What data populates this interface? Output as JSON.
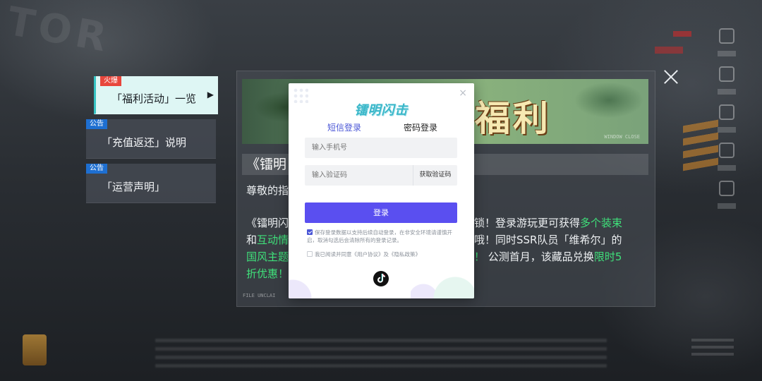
{
  "sidebar": {
    "items": [
      {
        "tag": "火爆",
        "label": "「福利活动」一览",
        "active": true
      },
      {
        "tag": "公告",
        "label": "「充值返还」说明",
        "active": false
      },
      {
        "tag": "公告",
        "label": "「运营声明」",
        "active": false
      }
    ],
    "active_arrow": "▶"
  },
  "announcement": {
    "banner_title": "福利",
    "banner_small": "WINDOW CLOSE",
    "heading": "《镭明",
    "greeting": "尊敬的指",
    "paragraph": {
      "line1_a": "《镭明闪",
      "line1_b": "锁！登录游玩更可获得",
      "line1_green": "多个装束",
      "line2_a": "和",
      "line2_green": "互动情",
      "line2_b": "哦！同时SSR队员「维希尔」的",
      "line3_green_a": "国风主题",
      "line3_green_b": "！",
      "line3_b": "公测首月，该藏品兑换",
      "line3_green_c": "限时5",
      "line4_green": "折优惠！"
    },
    "file_note": "FILE UNCLAI"
  },
  "login": {
    "logo": "镭明闪击",
    "close": "×",
    "tab_sms": "短信登录",
    "tab_password": "密码登录",
    "phone_placeholder": "输入手机号",
    "code_placeholder": "输入验证码",
    "get_code": "获取验证码",
    "login_button": "登录",
    "save_login_text": "保存登录数据以支持后续自动登录，在非安全环境请谨慎开启，取消勾选后会清除所有的登录记录。",
    "save_login_checked": true,
    "agree_text": "我已阅读并同意《用户协议》及《隐私政策》",
    "agree_checked": false,
    "third_party": "tiktok-icon"
  },
  "colors": {
    "accent_purple": "#5a4ff0",
    "tab_active": "#4a56d6",
    "highlight_green": "#3fe07a",
    "hot_tag": "#e8463c",
    "notice_tag": "#1e6fd1"
  }
}
